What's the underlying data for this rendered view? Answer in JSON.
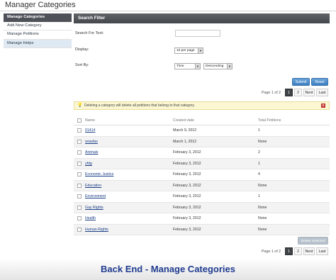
{
  "header": {
    "title": "Manager Categories"
  },
  "sidebar": {
    "items": [
      {
        "label": "Manage Categories"
      },
      {
        "label": "Add New Category"
      },
      {
        "label": "Manage Petitions"
      },
      {
        "label": "Manage Helps"
      }
    ]
  },
  "filter": {
    "title": "Search Filter",
    "search_label": "Search For Text:",
    "search_value": "",
    "display_label": "Display:",
    "display_value": "10 per page",
    "sort_label": "Sort By:",
    "sort_field": "Time",
    "sort_order": "Descending",
    "submit_label": "Submit",
    "reset_label": "Reset"
  },
  "pager": {
    "label": "Page 1 of 2",
    "pages": [
      "1",
      "2"
    ],
    "next": "Next",
    "last": "Last"
  },
  "notice": {
    "text": "Deleting a category will delete all petitions that belong to that category.",
    "close": "x"
  },
  "table": {
    "columns": [
      "Name",
      "Created date",
      "Total Petitions"
    ],
    "rows": [
      {
        "name": "01414",
        "date": "March 9, 2012",
        "total": "1"
      },
      {
        "name": "wrasfas",
        "date": "March 1, 2012",
        "total": "None"
      },
      {
        "name": "Animals",
        "date": "February 3, 2012",
        "total": "2"
      },
      {
        "name": "yfdg",
        "date": "February 3, 2012",
        "total": "1"
      },
      {
        "name": "Economic Justice",
        "date": "February 3, 2012",
        "total": "4"
      },
      {
        "name": "Education",
        "date": "February 3, 2012",
        "total": "None"
      },
      {
        "name": "Environment",
        "date": "February 3, 2012",
        "total": "1"
      },
      {
        "name": "Gay Rights",
        "date": "February 3, 2012",
        "total": "None"
      },
      {
        "name": "Health",
        "date": "February 3, 2012",
        "total": "None"
      },
      {
        "name": "Human Rights",
        "date": "February 3, 2012",
        "total": "None"
      }
    ]
  },
  "delete_selected_label": "Delete Selected",
  "caption": "Back End - Manage Categories",
  "colors": {
    "accent_blue": "#3d7fc2",
    "header_dark": "#4e5157",
    "notice_bg": "#fbf7d3",
    "caption": "#1f3b8f"
  }
}
